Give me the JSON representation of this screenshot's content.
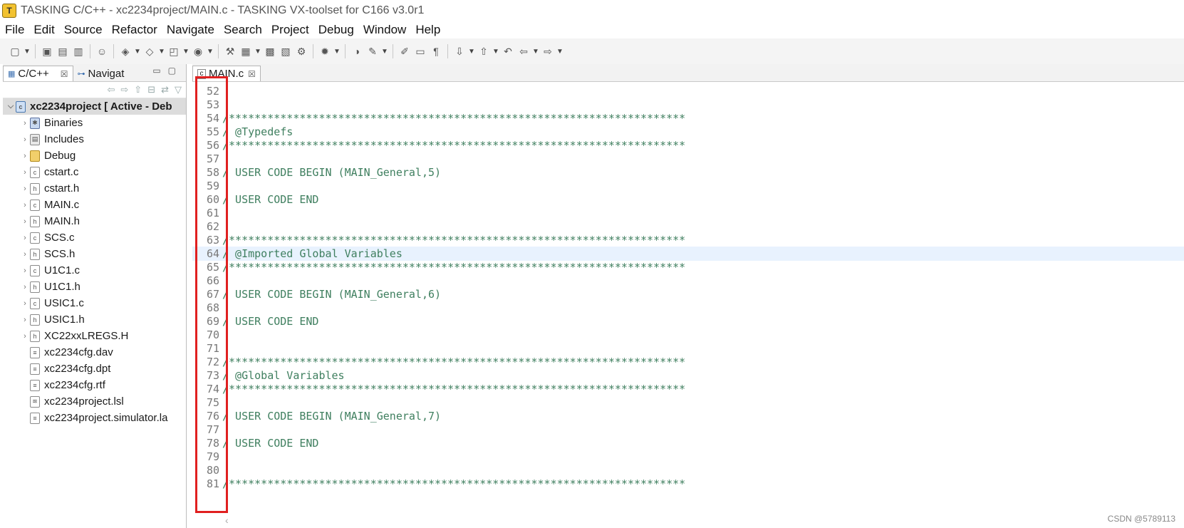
{
  "window": {
    "title": "TASKING C/C++ - xc2234project/MAIN.c - TASKING VX-toolset for C166 v3.0r1",
    "app_icon": "T"
  },
  "menubar": [
    "File",
    "Edit",
    "Source",
    "Refactor",
    "Navigate",
    "Search",
    "Project",
    "Debug",
    "Window",
    "Help"
  ],
  "left_panel": {
    "tabs": [
      {
        "label": "C/C++",
        "active": true
      },
      {
        "label": "Navigat",
        "active": false
      }
    ],
    "tree": [
      {
        "label": "xc2234project [ Active - Deb",
        "type": "project",
        "level": 0,
        "arrow": "v"
      },
      {
        "label": "Binaries",
        "type": "binaries",
        "level": 1,
        "arrow": ">"
      },
      {
        "label": "Includes",
        "type": "includes",
        "level": 1,
        "arrow": ">"
      },
      {
        "label": "Debug",
        "type": "folder",
        "level": 1,
        "arrow": ">"
      },
      {
        "label": "cstart.c",
        "type": "c",
        "level": 1,
        "arrow": ">"
      },
      {
        "label": "cstart.h",
        "type": "h",
        "level": 1,
        "arrow": ">"
      },
      {
        "label": "MAIN.c",
        "type": "c",
        "level": 1,
        "arrow": ">"
      },
      {
        "label": "MAIN.h",
        "type": "h",
        "level": 1,
        "arrow": ">"
      },
      {
        "label": "SCS.c",
        "type": "c",
        "level": 1,
        "arrow": ">"
      },
      {
        "label": "SCS.h",
        "type": "h",
        "level": 1,
        "arrow": ">"
      },
      {
        "label": "U1C1.c",
        "type": "c",
        "level": 1,
        "arrow": ">"
      },
      {
        "label": "U1C1.h",
        "type": "h",
        "level": 1,
        "arrow": ">"
      },
      {
        "label": "USIC1.c",
        "type": "c",
        "level": 1,
        "arrow": ">"
      },
      {
        "label": "USIC1.h",
        "type": "h",
        "level": 1,
        "arrow": ">"
      },
      {
        "label": "XC22xxLREGS.H",
        "type": "h",
        "level": 1,
        "arrow": ">"
      },
      {
        "label": "xc2234cfg.dav",
        "type": "file",
        "level": 1,
        "arrow": ""
      },
      {
        "label": "xc2234cfg.dpt",
        "type": "file",
        "level": 1,
        "arrow": ""
      },
      {
        "label": "xc2234cfg.rtf",
        "type": "file",
        "level": 1,
        "arrow": ""
      },
      {
        "label": "xc2234project.lsl",
        "type": "lsl",
        "level": 1,
        "arrow": ""
      },
      {
        "label": "xc2234project.simulator.la",
        "type": "file",
        "level": 1,
        "arrow": ""
      }
    ]
  },
  "editor": {
    "tab_label": "MAIN.c",
    "current_line": 64,
    "lines": [
      {
        "n": "52",
        "text": ""
      },
      {
        "n": "53",
        "text": ""
      },
      {
        "n": "54",
        "text": "/***********************************************************************"
      },
      {
        "n": "55",
        "text": "/ @Typedefs"
      },
      {
        "n": "56",
        "text": "/***********************************************************************"
      },
      {
        "n": "57",
        "text": ""
      },
      {
        "n": "58",
        "text": "/ USER CODE BEGIN (MAIN_General,5)"
      },
      {
        "n": "59",
        "text": ""
      },
      {
        "n": "60",
        "text": "/ USER CODE END"
      },
      {
        "n": "61",
        "text": ""
      },
      {
        "n": "62",
        "text": ""
      },
      {
        "n": "63",
        "text": "/***********************************************************************"
      },
      {
        "n": "64",
        "text": "/ @Imported Global Variables"
      },
      {
        "n": "65",
        "text": "/***********************************************************************"
      },
      {
        "n": "66",
        "text": ""
      },
      {
        "n": "67",
        "text": "/ USER CODE BEGIN (MAIN_General,6)"
      },
      {
        "n": "68",
        "text": ""
      },
      {
        "n": "69",
        "text": "/ USER CODE END"
      },
      {
        "n": "70",
        "text": ""
      },
      {
        "n": "71",
        "text": ""
      },
      {
        "n": "72",
        "text": "/***********************************************************************"
      },
      {
        "n": "73",
        "text": "/ @Global Variables"
      },
      {
        "n": "74",
        "text": "/***********************************************************************"
      },
      {
        "n": "75",
        "text": ""
      },
      {
        "n": "76",
        "text": "/ USER CODE BEGIN (MAIN_General,7)"
      },
      {
        "n": "77",
        "text": ""
      },
      {
        "n": "78",
        "text": "/ USER CODE END"
      },
      {
        "n": "79",
        "text": ""
      },
      {
        "n": "80",
        "text": ""
      },
      {
        "n": "81",
        "text": "/***********************************************************************"
      }
    ]
  },
  "watermark": "CSDN @5789113",
  "colors": {
    "comment": "#3f7f5f",
    "line_number": "#787878",
    "current_line_bg": "#e8f2fe",
    "highlight_box": "#e02020",
    "toolbar_bg": "#f4f4f4"
  }
}
